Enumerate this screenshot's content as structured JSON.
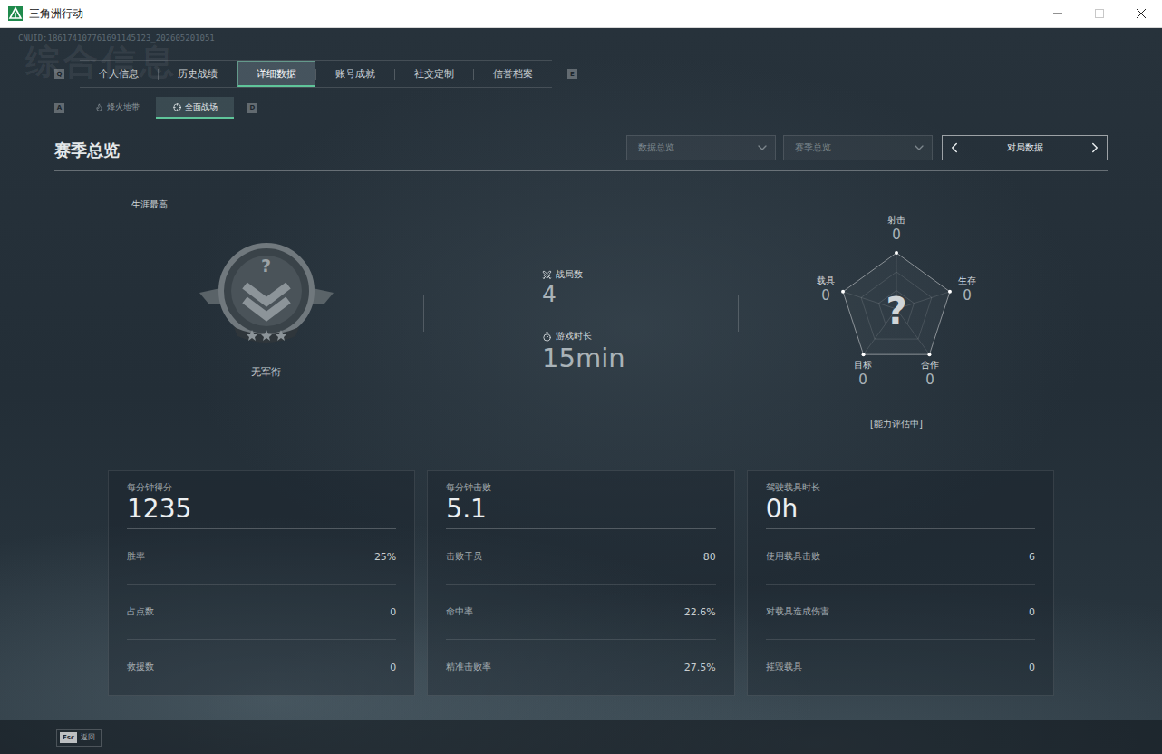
{
  "window": {
    "title": "三角洲行动"
  },
  "uid": "CNUID:186174107761691145123_202605201051",
  "watermark": "综合信息",
  "tabs": {
    "prev_key": "Q",
    "next_key": "E",
    "items": [
      {
        "label": "个人信息",
        "selected": false
      },
      {
        "label": "历史战绩",
        "selected": false
      },
      {
        "label": "详细数据",
        "selected": true
      },
      {
        "label": "账号成就",
        "selected": false
      },
      {
        "label": "社交定制",
        "selected": false
      },
      {
        "label": "信誉档案",
        "selected": false
      }
    ]
  },
  "subtabs": {
    "prev_key": "A",
    "next_key": "D",
    "items": [
      {
        "label": "烽火地带",
        "selected": false
      },
      {
        "label": "全面战场",
        "selected": true
      }
    ]
  },
  "section": {
    "title": "赛季总览",
    "filters": [
      {
        "label": "数据总览"
      },
      {
        "label": "赛季总览"
      }
    ],
    "pager": {
      "label": "对局数据"
    }
  },
  "rank": {
    "caption": "生涯最高",
    "mark": "?",
    "name": "无军衔"
  },
  "stats": [
    {
      "label": "战局数",
      "value": "4",
      "kind": "count"
    },
    {
      "label": "游戏时长",
      "value": "15min",
      "kind": "time"
    }
  ],
  "radar": {
    "mark": "?",
    "status": "[能力评估中]",
    "axes": [
      {
        "label": "射击",
        "value": "0"
      },
      {
        "label": "生存",
        "value": "0"
      },
      {
        "label": "合作",
        "value": "0"
      },
      {
        "label": "目标",
        "value": "0"
      },
      {
        "label": "载具",
        "value": "0"
      }
    ]
  },
  "cards": [
    {
      "title": "每分钟得分",
      "value": "1235",
      "rows": [
        {
          "label": "胜率",
          "value": "25%"
        },
        {
          "label": "占点数",
          "value": "0"
        },
        {
          "label": "救援数",
          "value": "0"
        }
      ]
    },
    {
      "title": "每分钟击败",
      "value": "5.1",
      "rows": [
        {
          "label": "击败干员",
          "value": "80"
        },
        {
          "label": "命中率",
          "value": "22.6%"
        },
        {
          "label": "精准击败率",
          "value": "27.5%"
        }
      ]
    },
    {
      "title": "驾驶载具时长",
      "value": "0h",
      "rows": [
        {
          "label": "使用载具击败",
          "value": "6"
        },
        {
          "label": "对载具造成伤害",
          "value": "0"
        },
        {
          "label": "摧毁载具",
          "value": "0"
        }
      ]
    }
  ],
  "footer": {
    "key": "Esc",
    "label": "返回"
  }
}
